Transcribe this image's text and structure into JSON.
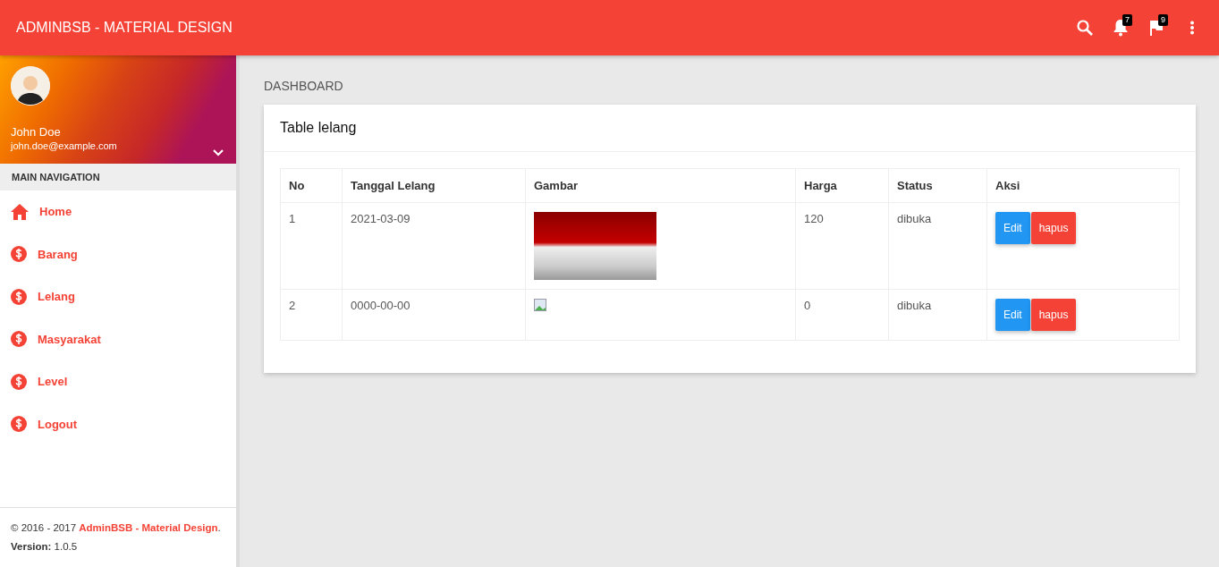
{
  "topbar": {
    "title": "ADMINBSB - MATERIAL DESIGN",
    "notifications": "7",
    "flags": "9"
  },
  "user": {
    "name": "John Doe",
    "email": "john.doe@example.com"
  },
  "sidebar": {
    "header": "MAIN NAVIGATION",
    "items": [
      {
        "label": "Home",
        "kind": "home"
      },
      {
        "label": "Barang",
        "kind": "dollar"
      },
      {
        "label": "Lelang",
        "kind": "dollar"
      },
      {
        "label": "Masyarakat",
        "kind": "dollar"
      },
      {
        "label": "Level",
        "kind": "dollar"
      },
      {
        "label": "Logout",
        "kind": "dollar"
      }
    ]
  },
  "footer": {
    "copyright": "© 2016 - 2017 ",
    "link": "AdminBSB - Material Design",
    "suffix": ".",
    "version": "**Version:** 1.0.5"
  },
  "breadcrumb": "DASHBOARD",
  "card": {
    "title": "Table lelang"
  },
  "table": {
    "columns": [
      "No",
      "Tanggal Lelang",
      "Gambar",
      "Harga",
      "Status",
      "Aksi"
    ],
    "rows": [
      {
        "no": "1",
        "date": "2021-03-09",
        "kind": "flag",
        "price": "120",
        "status": "dibuka",
        "actions": [
          "Edit",
          "hapus"
        ]
      },
      {
        "no": "2",
        "date": "0000-00-00",
        "kind": "broken",
        "price": "0",
        "status": "dibuka",
        "actions": [
          "Edit",
          "hapus"
        ]
      }
    ]
  }
}
